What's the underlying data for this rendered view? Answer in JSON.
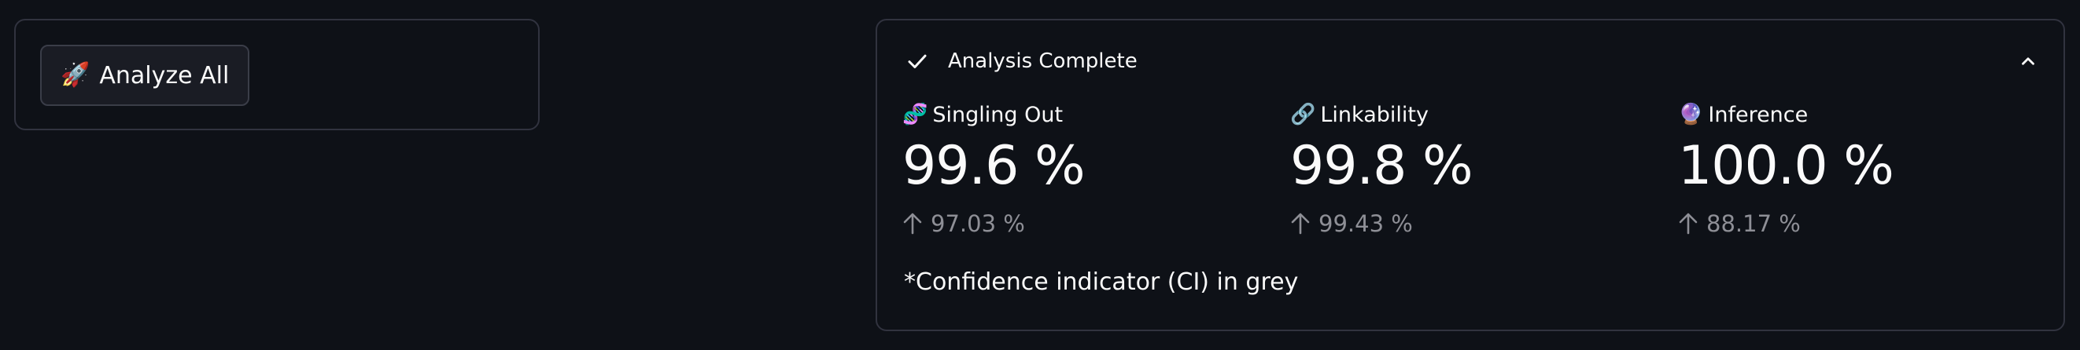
{
  "toolbar": {
    "analyze_label": "Analyze All",
    "analyze_icon": "rocket-emoji"
  },
  "status": {
    "title": "Analysis Complete",
    "icons": [
      "check-icon",
      "chevron-up-icon"
    ]
  },
  "metrics": [
    {
      "label": "Singling Out",
      "icon": "dna-emoji",
      "value": "99.6 %",
      "delta": "97.03 %",
      "delta_direction": "up"
    },
    {
      "label": "Linkability",
      "icon": "link-emoji",
      "value": "99.8 %",
      "delta": "99.43 %",
      "delta_direction": "up"
    },
    {
      "label": "Inference",
      "icon": "crystal-ball-emoji",
      "value": "100.0 %",
      "delta": "88.17 %",
      "delta_direction": "up"
    }
  ],
  "footnote": "*Confidence indicator (CI) in grey",
  "colors": {
    "background": "#0e1117",
    "border": "#31333f",
    "text": "#fafafa",
    "delta_grey": "#8e8f96"
  }
}
